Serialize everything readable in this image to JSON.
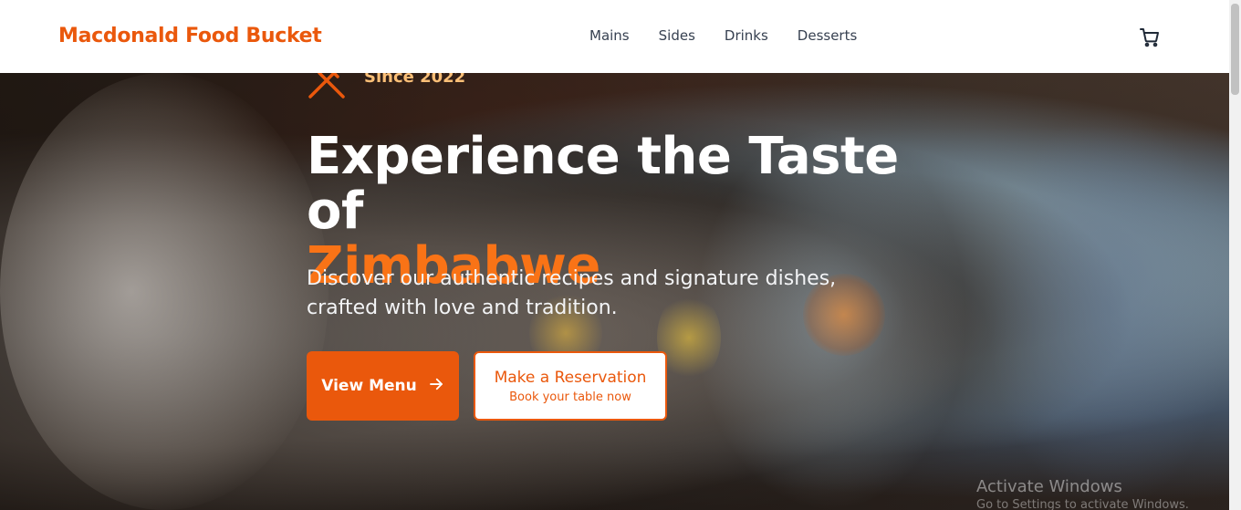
{
  "header": {
    "brand": "Macdonald Food Bucket",
    "nav": [
      {
        "label": "Mains"
      },
      {
        "label": "Sides"
      },
      {
        "label": "Drinks"
      },
      {
        "label": "Desserts"
      }
    ],
    "cart_icon": "shopping-cart-icon"
  },
  "hero": {
    "since_icon": "utensils-crossed-icon",
    "since_label": "Since 2022",
    "headline": "Experience the Taste of",
    "headline_accent": "Zimbabwe",
    "subtitle": "Discover our authentic recipes and signature dishes, crafted with love and tradition.",
    "primary_button": {
      "label": "View Menu",
      "icon": "arrow-right-icon"
    },
    "secondary_button": {
      "label": "Make a Reservation",
      "sublabel": "Book your table now"
    }
  },
  "system": {
    "watermark_title": "Activate Windows",
    "watermark_sub": "Go to Settings to activate Windows."
  },
  "colors": {
    "accent": "#ea580c",
    "accent_light": "#f97316",
    "nav_text": "#374151",
    "since_text": "#fbbf77"
  }
}
